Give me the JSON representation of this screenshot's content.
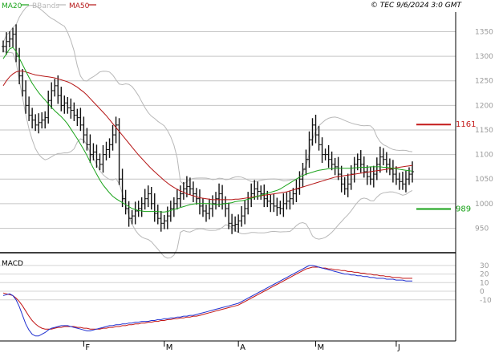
{
  "header": {
    "legend_items": [
      {
        "label": "MA20",
        "color": "#19a319"
      },
      {
        "label": "BBands",
        "color": "#b8b8b8"
      },
      {
        "label": "MA50",
        "color": "#b51515"
      }
    ],
    "copyright": "© TEC 9/6/2024 3:0 GMT"
  },
  "price_panel": {
    "y_ticks": [
      950,
      1000,
      1050,
      1100,
      1150,
      1200,
      1250,
      1300,
      1350
    ],
    "ylim": [
      905,
      1390
    ],
    "grid_color": "#c6c6c6",
    "markers": [
      {
        "label": "1161",
        "value": 1161,
        "color": "#c41a1a"
      },
      {
        "label": "989",
        "value": 989,
        "color": "#14a014"
      }
    ]
  },
  "macd_panel": {
    "label": "MACD",
    "y_tick_labels": [
      "30",
      "20",
      "10",
      "0",
      "-10"
    ],
    "y_tick_values": [
      30,
      20,
      10,
      0,
      -10
    ],
    "ylim": [
      -55,
      42
    ]
  },
  "x_axis": {
    "month_labels": [
      "F",
      "M",
      "A",
      "M",
      "J"
    ],
    "month_index": [
      25,
      50,
      73,
      97,
      122
    ]
  },
  "chart_data": {
    "type": "ohlc",
    "series_count": 128,
    "close": [
      1320,
      1330,
      1335,
      1345,
      1300,
      1260,
      1230,
      1200,
      1180,
      1170,
      1160,
      1165,
      1170,
      1175,
      1210,
      1230,
      1240,
      1220,
      1200,
      1205,
      1195,
      1190,
      1180,
      1175,
      1160,
      1140,
      1120,
      1100,
      1105,
      1090,
      1080,
      1100,
      1110,
      1120,
      1140,
      1160,
      1050,
      1010,
      990,
      970,
      975,
      985,
      990,
      1000,
      1010,
      1020,
      1000,
      980,
      970,
      960,
      965,
      975,
      990,
      1000,
      1010,
      1020,
      1030,
      1035,
      1030,
      1020,
      1010,
      995,
      985,
      980,
      990,
      1000,
      1010,
      1020,
      1000,
      990,
      960,
      955,
      958,
      965,
      975,
      990,
      1010,
      1020,
      1030,
      1025,
      1020,
      1010,
      1005,
      1000,
      995,
      992,
      990,
      1000,
      1005,
      1010,
      1020,
      1030,
      1050,
      1070,
      1090,
      1130,
      1160,
      1140,
      1120,
      1100,
      1100,
      1090,
      1080,
      1075,
      1060,
      1040,
      1030,
      1040,
      1060,
      1080,
      1090,
      1080,
      1065,
      1055,
      1050,
      1060,
      1080,
      1095,
      1090,
      1080,
      1070,
      1060,
      1050,
      1045,
      1040,
      1050,
      1060,
      1065
    ],
    "ma20": [
      1295,
      1305,
      1315,
      1318,
      1310,
      1296,
      1283,
      1270,
      1257,
      1245,
      1235,
      1226,
      1218,
      1211,
      1203,
      1196,
      1189,
      1183,
      1177,
      1170,
      1162,
      1152,
      1142,
      1132,
      1121,
      1110,
      1098,
      1085,
      1072,
      1060,
      1048,
      1038,
      1030,
      1022,
      1015,
      1010,
      1006,
      1002,
      998,
      994,
      990,
      988,
      986,
      985,
      984,
      984,
      984,
      984,
      984,
      983,
      983,
      984,
      986,
      988,
      990,
      992,
      994,
      996,
      998,
      999,
      1000,
      1000,
      1000,
      1000,
      1000,
      999,
      998,
      998,
      999,
      1000,
      1001,
      1002,
      1004,
      1005,
      1006,
      1007,
      1009,
      1011,
      1013,
      1015,
      1017,
      1019,
      1021,
      1023,
      1025,
      1027,
      1030,
      1034,
      1038,
      1042,
      1046,
      1050,
      1054,
      1057,
      1060,
      1062,
      1064,
      1066,
      1068,
      1069,
      1070,
      1071,
      1071,
      1072,
      1072,
      1072,
      1072,
      1072,
      1072,
      1073,
      1073,
      1074,
      1074,
      1074,
      1075,
      1075,
      1075,
      1075,
      1074,
      1074,
      1073,
      1072,
      1071,
      1070,
      1069,
      1068,
      1067,
      1066
    ],
    "ma50": [
      1240,
      1250,
      1258,
      1264,
      1268,
      1270,
      1270,
      1268,
      1266,
      1264,
      1262,
      1261,
      1260,
      1259,
      1258,
      1257,
      1256,
      1254,
      1252,
      1250,
      1248,
      1245,
      1241,
      1237,
      1232,
      1227,
      1221,
      1214,
      1207,
      1200,
      1193,
      1186,
      1179,
      1171,
      1163,
      1155,
      1147,
      1139,
      1131,
      1123,
      1115,
      1107,
      1099,
      1092,
      1085,
      1078,
      1071,
      1065,
      1059,
      1053,
      1047,
      1042,
      1037,
      1033,
      1029,
      1026,
      1023,
      1020,
      1018,
      1016,
      1014,
      1012,
      1011,
      1010,
      1009,
      1008,
      1008,
      1008,
      1008,
      1008,
      1008,
      1008,
      1009,
      1009,
      1010,
      1011,
      1012,
      1013,
      1014,
      1015,
      1016,
      1017,
      1018,
      1019,
      1020,
      1021,
      1022,
      1023,
      1024,
      1026,
      1028,
      1030,
      1032,
      1034,
      1036,
      1038,
      1040,
      1042,
      1044,
      1046,
      1048,
      1050,
      1052,
      1054,
      1055,
      1056,
      1057,
      1058,
      1059,
      1060,
      1061,
      1062,
      1063,
      1064,
      1065,
      1066,
      1067,
      1068,
      1069,
      1070,
      1071,
      1072,
      1073,
      1074,
      1075,
      1076,
      1077,
      1078
    ],
    "macd": [
      -5,
      -4,
      -3,
      -5,
      -10,
      -18,
      -28,
      -38,
      -45,
      -50,
      -52,
      -52,
      -50,
      -48,
      -45,
      -43,
      -42,
      -41,
      -40,
      -40,
      -40,
      -41,
      -42,
      -43,
      -44,
      -45,
      -46,
      -46,
      -45,
      -44,
      -43,
      -42,
      -41,
      -40,
      -40,
      -39,
      -39,
      -38,
      -38,
      -37,
      -37,
      -36,
      -36,
      -35,
      -35,
      -35,
      -34,
      -34,
      -33,
      -33,
      -32,
      -32,
      -31,
      -31,
      -30,
      -30,
      -29,
      -29,
      -28,
      -28,
      -27,
      -26,
      -25,
      -24,
      -23,
      -22,
      -21,
      -20,
      -19,
      -18,
      -17,
      -16,
      -15,
      -14,
      -12,
      -10,
      -8,
      -6,
      -4,
      -2,
      0,
      2,
      4,
      6,
      8,
      10,
      12,
      14,
      16,
      18,
      20,
      22,
      24,
      26,
      28,
      30,
      30,
      29,
      28,
      27,
      26,
      25,
      24,
      23,
      22,
      21,
      20,
      20,
      19,
      19,
      18,
      18,
      17,
      17,
      16,
      16,
      15,
      15,
      15,
      14,
      14,
      14,
      13,
      13,
      13,
      12,
      12,
      12
    ],
    "signal": [
      -2,
      -3,
      -4,
      -5,
      -8,
      -12,
      -17,
      -23,
      -29,
      -34,
      -38,
      -41,
      -43,
      -44,
      -44,
      -44,
      -43,
      -42,
      -42,
      -41,
      -41,
      -41,
      -41,
      -42,
      -42,
      -43,
      -43,
      -44,
      -44,
      -44,
      -44,
      -43,
      -43,
      -42,
      -42,
      -41,
      -41,
      -40,
      -40,
      -39,
      -39,
      -38,
      -38,
      -37,
      -37,
      -36,
      -36,
      -35,
      -35,
      -34,
      -34,
      -33,
      -33,
      -32,
      -32,
      -31,
      -31,
      -30,
      -30,
      -29,
      -29,
      -28,
      -27,
      -26,
      -25,
      -24,
      -23,
      -22,
      -21,
      -20,
      -19,
      -18,
      -17,
      -16,
      -14,
      -12,
      -10,
      -8,
      -6,
      -4,
      -2,
      0,
      2,
      4,
      6,
      8,
      10,
      12,
      14,
      16,
      18,
      20,
      22,
      24,
      26,
      27,
      28,
      28,
      28,
      27,
      27,
      26,
      26,
      25,
      25,
      24,
      24,
      23,
      23,
      22,
      22,
      21,
      21,
      20,
      20,
      19,
      19,
      18,
      18,
      17,
      17,
      16,
      16,
      16,
      15,
      15,
      15,
      15
    ]
  }
}
